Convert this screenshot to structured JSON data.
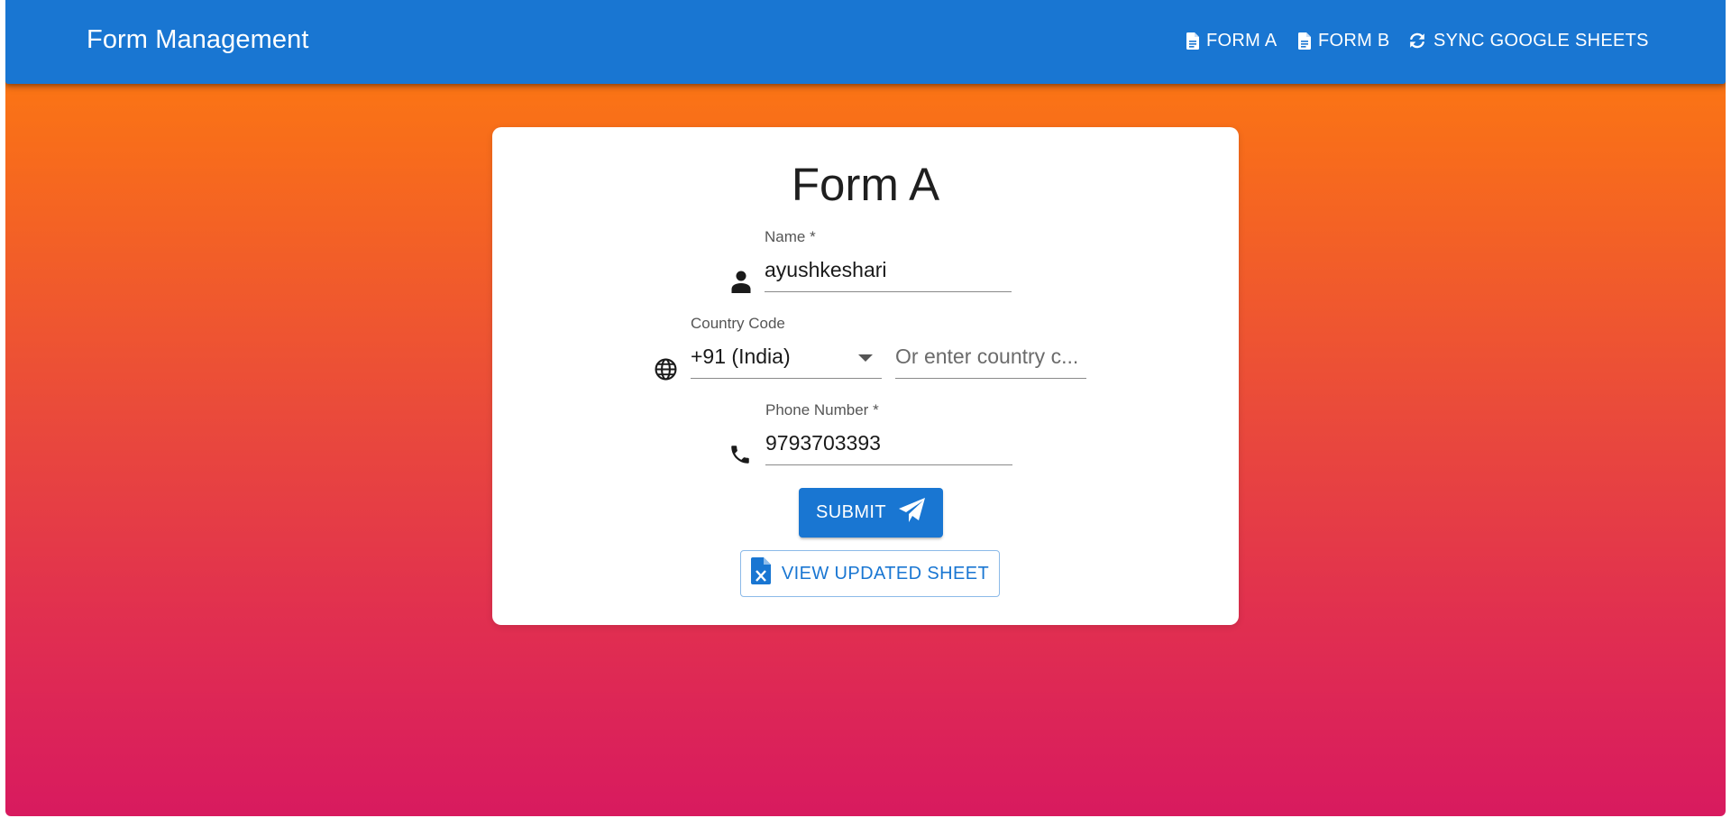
{
  "app": {
    "title": "Form Management"
  },
  "nav": {
    "form_a": "FORM A",
    "form_b": "FORM B",
    "sync": "SYNC GOOGLE SHEETS"
  },
  "form": {
    "title": "Form A",
    "name": {
      "label": "Name *",
      "value": "ayushkeshari",
      "icon": "person-icon"
    },
    "country_code": {
      "label": "Country Code",
      "selected": "+91 (India)",
      "custom_placeholder": "Or enter country c...",
      "icon": "globe-icon"
    },
    "phone": {
      "label": "Phone Number *",
      "value": "9793703393",
      "icon": "phone-icon"
    },
    "submit_label": "SUBMIT",
    "view_sheet_label": "VIEW UPDATED SHEET"
  },
  "colors": {
    "appbar": "#1976d2",
    "gradient_top": "#fe7f0c",
    "gradient_bottom": "#d81a5f",
    "primary": "#1976d2"
  }
}
